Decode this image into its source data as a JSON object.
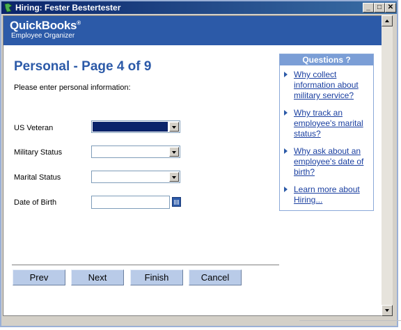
{
  "window": {
    "title": "Hiring: Fester Bestertester"
  },
  "banner": {
    "brand": "QuickBooks",
    "brand_mark": "®",
    "subbrand": "Employee Organizer"
  },
  "page": {
    "heading": "Personal - Page 4 of 9",
    "instruction": "Please enter personal information:"
  },
  "form": {
    "us_veteran": {
      "label": "US Veteran",
      "value": ""
    },
    "military_status": {
      "label": "Military Status",
      "value": ""
    },
    "marital_status": {
      "label": "Marital Status",
      "value": ""
    },
    "date_of_birth": {
      "label": "Date of Birth",
      "value": ""
    }
  },
  "questions": {
    "header": "Questions ?",
    "items": [
      {
        "text": "Why collect information about military service?"
      },
      {
        "text": "Why track an employee's marital status?"
      },
      {
        "text": "Why ask about an employee's date of birth?"
      },
      {
        "text": "Learn more about Hiring..."
      }
    ]
  },
  "buttons": {
    "prev": "Prev",
    "next": "Next",
    "finish": "Finish",
    "cancel": "Cancel"
  },
  "colors": {
    "accent": "#2c5aa8",
    "title_bar": "#0a246a",
    "button": "#b9cbe8"
  }
}
